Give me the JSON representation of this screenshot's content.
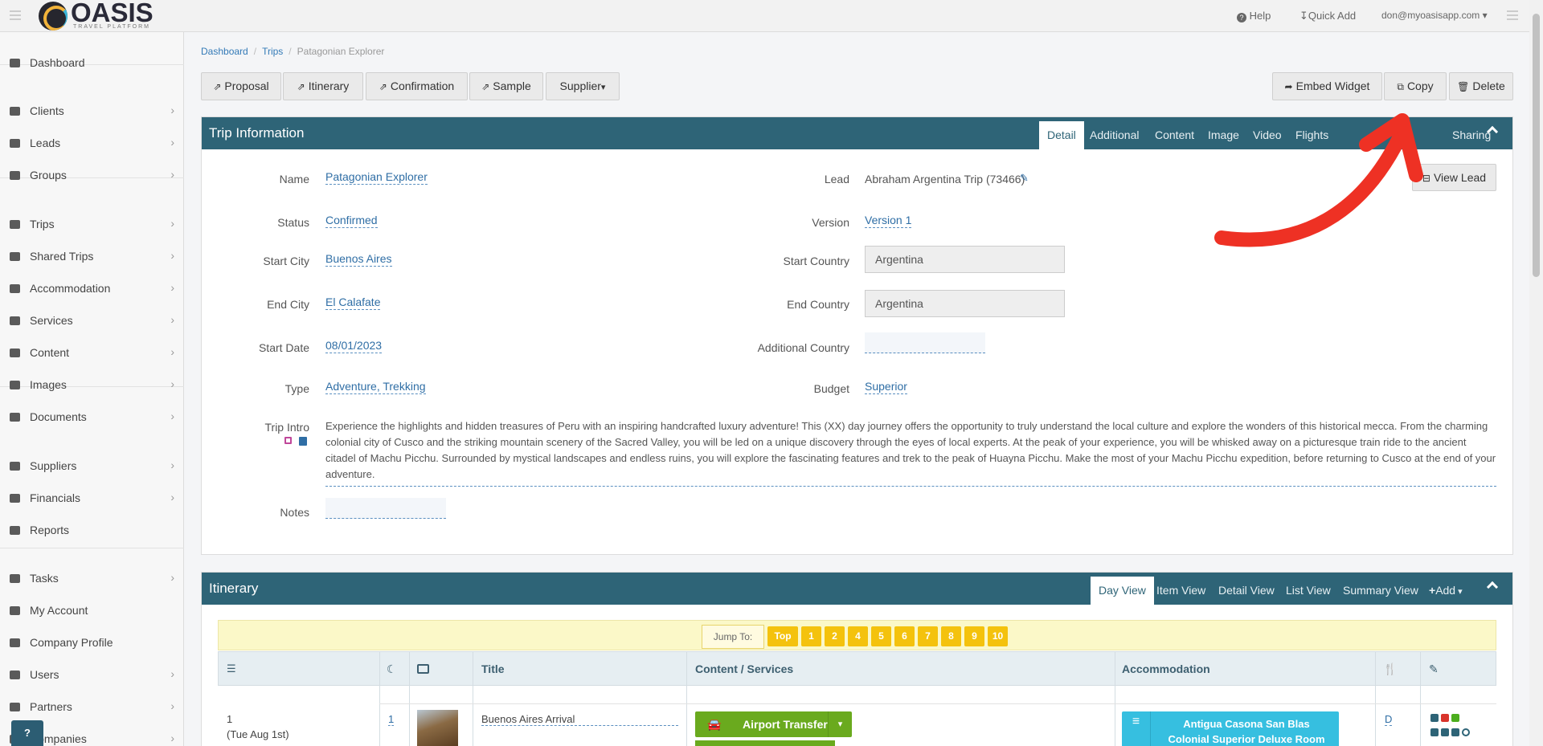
{
  "app": {
    "logo_text": "OASIS",
    "logo_sub": "TRAVEL PLATFORM"
  },
  "topbar": {
    "help": "Help",
    "quick_add": "Quick Add",
    "user": "don@myoasisapp.com"
  },
  "sidebar": {
    "items": [
      {
        "label": "Dashboard",
        "icon": "monitor-icon",
        "chevron": false
      },
      {
        "label": "Clients",
        "icon": "user-icon",
        "chevron": true
      },
      {
        "label": "Leads",
        "icon": "inbox-icon",
        "chevron": true
      },
      {
        "label": "Groups",
        "icon": "users-icon",
        "chevron": true
      },
      {
        "label": "Trips",
        "icon": "suitcase-icon",
        "chevron": true
      },
      {
        "label": "Shared Trips",
        "icon": "suitcase-icon",
        "chevron": true
      },
      {
        "label": "Accommodation",
        "icon": "building-icon",
        "chevron": true
      },
      {
        "label": "Services",
        "icon": "binoculars-icon",
        "chevron": true
      },
      {
        "label": "Content",
        "icon": "flag-icon",
        "chevron": true
      },
      {
        "label": "Images",
        "icon": "image-icon",
        "chevron": true
      },
      {
        "label": "Documents",
        "icon": "file-icon",
        "chevron": true
      },
      {
        "label": "Suppliers",
        "icon": "briefcase-icon",
        "chevron": true
      },
      {
        "label": "Financials",
        "icon": "money-icon",
        "chevron": true
      },
      {
        "label": "Reports",
        "icon": "table-icon",
        "chevron": false
      },
      {
        "label": "Tasks",
        "icon": "check-icon",
        "chevron": true
      },
      {
        "label": "My Account",
        "icon": "gear-icon",
        "chevron": false
      },
      {
        "label": "Company Profile",
        "icon": "gears-icon",
        "chevron": false
      },
      {
        "label": "Users",
        "icon": "user-icon",
        "chevron": true
      },
      {
        "label": "Partners",
        "icon": "users-icon",
        "chevron": true
      },
      {
        "label": "Companies",
        "icon": "building-icon",
        "chevron": true
      }
    ],
    "help_button": "?"
  },
  "breadcrumb": {
    "items": [
      "Dashboard",
      "Trips"
    ],
    "current": "Patagonian Explorer"
  },
  "actions": {
    "proposal": "Proposal",
    "itinerary": "Itinerary",
    "confirmation": "Confirmation",
    "sample": "Sample",
    "supplier": "Supplier",
    "embed_widget": "Embed Widget",
    "copy": "Copy",
    "delete": "Delete"
  },
  "trip_info": {
    "title": "Trip Information",
    "tabs": [
      "Detail",
      "Additional",
      "Content",
      "Image",
      "Video",
      "Flights",
      "",
      "Sharing"
    ],
    "tab_item": "em",
    "view_lead": "View Lead",
    "labels": {
      "name": "Name",
      "status": "Status",
      "start_city": "Start City",
      "end_city": "End City",
      "start_date": "Start Date",
      "type": "Type",
      "trip_intro": "Trip Intro",
      "notes": "Notes",
      "lead": "Lead",
      "version": "Version",
      "start_country": "Start Country",
      "end_country": "End Country",
      "additional_country": "Additional Country",
      "budget": "Budget"
    },
    "values": {
      "name": "Patagonian Explorer",
      "status": "Confirmed",
      "start_city": "Buenos Aires",
      "end_city": "El Calafate",
      "start_date": "08/01/2023",
      "type": "Adventure, Trekking",
      "lead": "Abraham Argentina Trip (73466)",
      "version": "Version 1",
      "start_country": "Argentina",
      "end_country": "Argentina",
      "budget": "Superior",
      "trip_intro": "Experience the highlights and hidden treasures of Peru with an inspiring handcrafted luxury adventure! This (XX) day journey offers the opportunity to truly understand the local culture and explore the wonders of this historical mecca. From the charming colonial city of Cusco and the striking mountain scenery of the Sacred Valley, you will be led on a unique discovery through the eyes of local experts. At the peak of your experience, you will be whisked away on a picturesque train ride to the ancient citadel of Machu Picchu. Surrounded by mystical landscapes and endless ruins, you will explore the fascinating features and trek to the peak of Huayna Picchu. Make the most of your Machu Picchu expedition, before returning to Cusco at the end of your adventure."
    }
  },
  "itinerary": {
    "title": "Itinerary",
    "tabs": [
      "Day View",
      "Item View",
      "Detail View",
      "List View",
      "Summary View"
    ],
    "add": "Add",
    "jump_label": "Jump To:",
    "jump_buttons": [
      "Top",
      "1",
      "2",
      "4",
      "5",
      "6",
      "7",
      "8",
      "9",
      "10"
    ],
    "columns": {
      "title": "Title",
      "content": "Content / Services",
      "accommodation": "Accommodation"
    },
    "row": {
      "day": "1",
      "date": "(Tue Aug 1st)",
      "nights": "1",
      "title": "Buenos Aires Arrival",
      "service": "Airport Transfer",
      "accommodation_line1": "Antigua Casona San Blas",
      "accommodation_line2": "Colonial Superior Deluxe Room",
      "meal": "D"
    }
  },
  "colors": {
    "header": "#2e6477",
    "accent_link": "#2f6ea5",
    "jump": "#f4c20d",
    "service": "#6aaa1e",
    "accom": "#36bfe0",
    "annotation": "#ee3124"
  }
}
